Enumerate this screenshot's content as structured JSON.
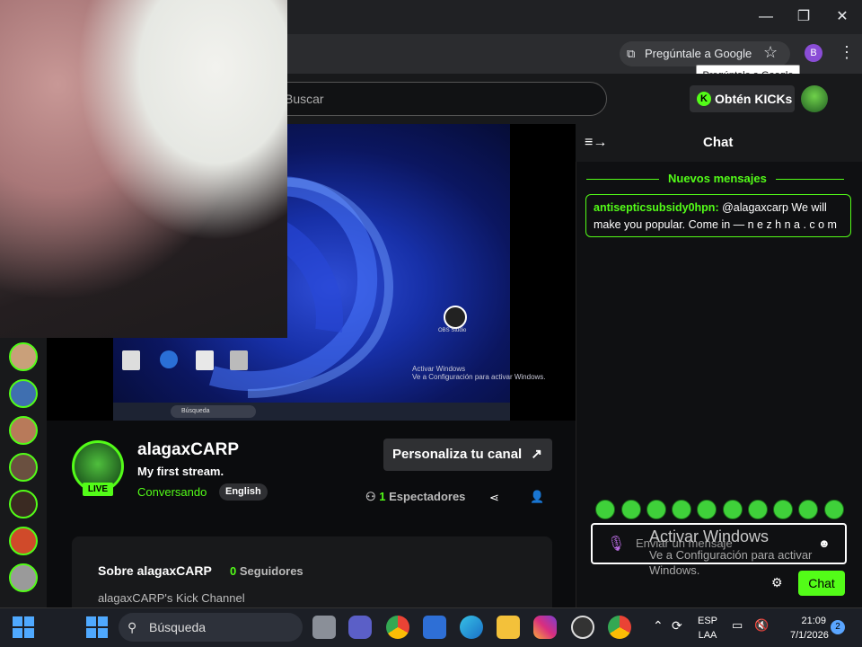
{
  "browser": {
    "window_controls": {
      "minimize": "—",
      "restore": "❐",
      "close": "✕"
    },
    "google_lens": "Pregúntale a Google",
    "tooltip": "Pregúntale a Google",
    "profile_initial": "B",
    "star_icon": "☆",
    "menu_icon": "⋮"
  },
  "kick_header": {
    "search_placeholder": "Buscar",
    "kicks_button": "Obtén KICKs",
    "kicks_badge": "K"
  },
  "stream_overlay": {
    "obs_label": "OBS Studio",
    "activate_windows_small": "Activar Windows\nVe a Configuración para activar Windows.",
    "mini_search": "Búsqueda"
  },
  "channel": {
    "name": "alagaxCARP",
    "live_badge": "LIVE",
    "stream_title": "My first stream.",
    "category": "Conversando",
    "language": "English",
    "customize_button": "Personaliza tu canal",
    "customize_icon": "↗",
    "viewer_count": "1",
    "viewers_label": "Espectadores",
    "share_icon": "⋖",
    "follow_icon": "👤"
  },
  "about": {
    "title": "Sobre alagaxCARP",
    "followers_count": "0",
    "followers_label": "Seguidores",
    "description": "alagaxCARP's Kick Channel"
  },
  "chat": {
    "title": "Chat",
    "collapse_icon": "≡→",
    "new_messages_divider": "Nuevos mensajes",
    "messages": [
      {
        "user": "antisepticsubsidy0hpn:",
        "text": " @alagaxcarp We will make you popular. Come in — n e z h n a . c o m"
      }
    ],
    "input_placeholder": "Enviar un mensaje",
    "send_button": "Chat",
    "gear_icon": "⚙",
    "emoji_icon": "☻",
    "mic_icon": "🎙"
  },
  "activate_windows": {
    "title": "Activar Windows",
    "subtitle": "Ve a Configuración para activar Windows."
  },
  "taskbar": {
    "search": "Búsqueda",
    "lang_top": "ESP",
    "lang_bottom": "LAA",
    "time": "21:09",
    "date": "7/1/2026",
    "notifications": "2"
  },
  "colors": {
    "kick_green": "#53fc18",
    "chrome_bg": "#202124",
    "taskbar_bg": "#1c1f26"
  }
}
